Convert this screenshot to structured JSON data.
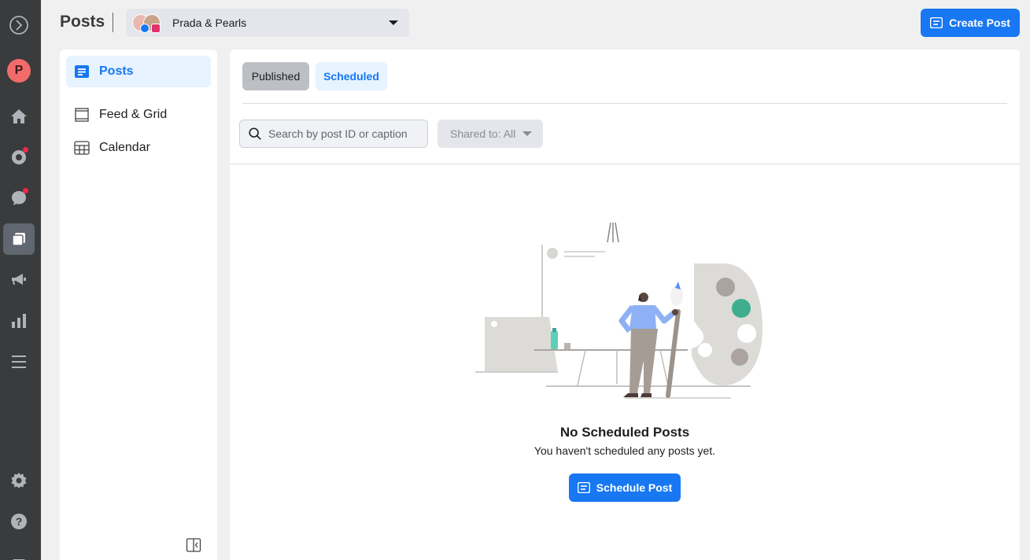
{
  "header": {
    "title": "Posts",
    "account_name": "Prada & Pearls",
    "create_label": "Create Post"
  },
  "rail": {
    "profile_initial": "P",
    "items": [
      "meta-logo-icon",
      "profile-avatar",
      "home-icon",
      "activity-icon",
      "inbox-icon",
      "posts-icon",
      "ads-icon",
      "insights-icon",
      "menu-icon",
      "settings-icon",
      "help-icon"
    ]
  },
  "sidebar": {
    "items": [
      {
        "label": "Posts",
        "icon": "posts-icon",
        "active": true
      },
      {
        "label": "Feed & Grid",
        "icon": "feed-grid-icon",
        "active": false
      },
      {
        "label": "Calendar",
        "icon": "calendar-icon",
        "active": false
      }
    ]
  },
  "main": {
    "tabs": [
      {
        "label": "Published",
        "active": false
      },
      {
        "label": "Scheduled",
        "active": true
      }
    ],
    "search_placeholder": "Search by post ID or caption",
    "shared_filter": "Shared to: All",
    "empty_title": "No Scheduled Posts",
    "empty_subtitle": "You haven't scheduled any posts yet.",
    "schedule_label": "Schedule Post"
  },
  "colors": {
    "accent": "#1877f2",
    "rail_bg": "#3a3b3c",
    "notification": "#f02849"
  }
}
